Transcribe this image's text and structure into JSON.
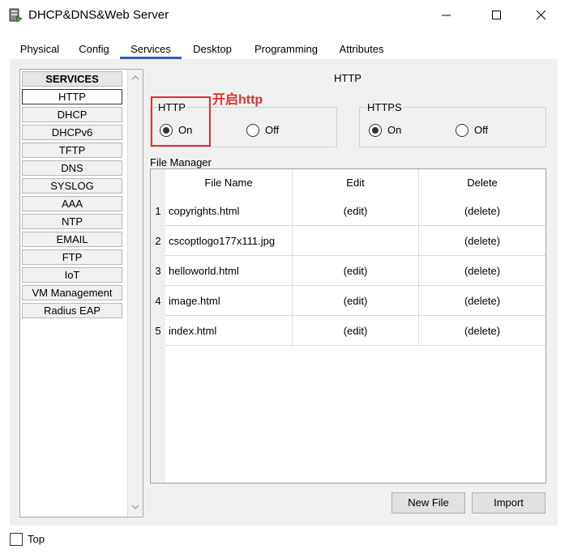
{
  "window": {
    "title": "DHCP&DNS&Web Server"
  },
  "tabs": [
    "Physical",
    "Config",
    "Services",
    "Desktop",
    "Programming",
    "Attributes"
  ],
  "services": {
    "header": "SERVICES",
    "items": [
      "HTTP",
      "DHCP",
      "DHCPv6",
      "TFTP",
      "DNS",
      "SYSLOG",
      "AAA",
      "NTP",
      "EMAIL",
      "FTP",
      "IoT",
      "VM Management",
      "Radius EAP"
    ]
  },
  "http_section": {
    "title": "HTTP",
    "http": {
      "legend": "HTTP",
      "on_label": "On",
      "off_label": "Off",
      "selected": "On"
    },
    "https": {
      "legend": "HTTPS",
      "on_label": "On",
      "off_label": "Off",
      "selected": "On"
    },
    "annotation": "开启http"
  },
  "file_manager": {
    "label": "File Manager",
    "columns": [
      "File Name",
      "Edit",
      "Delete"
    ],
    "rows": [
      {
        "num": "1",
        "name": "copyrights.html",
        "edit": "(edit)",
        "delete": "(delete)"
      },
      {
        "num": "2",
        "name": "cscoptlogo177x111.jpg",
        "edit": "",
        "delete": "(delete)"
      },
      {
        "num": "3",
        "name": "helloworld.html",
        "edit": "(edit)",
        "delete": "(delete)"
      },
      {
        "num": "4",
        "name": "image.html",
        "edit": "(edit)",
        "delete": "(delete)"
      },
      {
        "num": "5",
        "name": "index.html",
        "edit": "(edit)",
        "delete": "(delete)"
      }
    ]
  },
  "buttons": {
    "new_file": "New File",
    "import": "Import"
  },
  "footer": {
    "top_label": "Top"
  },
  "colors": {
    "accent_tab": "#2f5fb0",
    "annotation": "#e03030"
  }
}
